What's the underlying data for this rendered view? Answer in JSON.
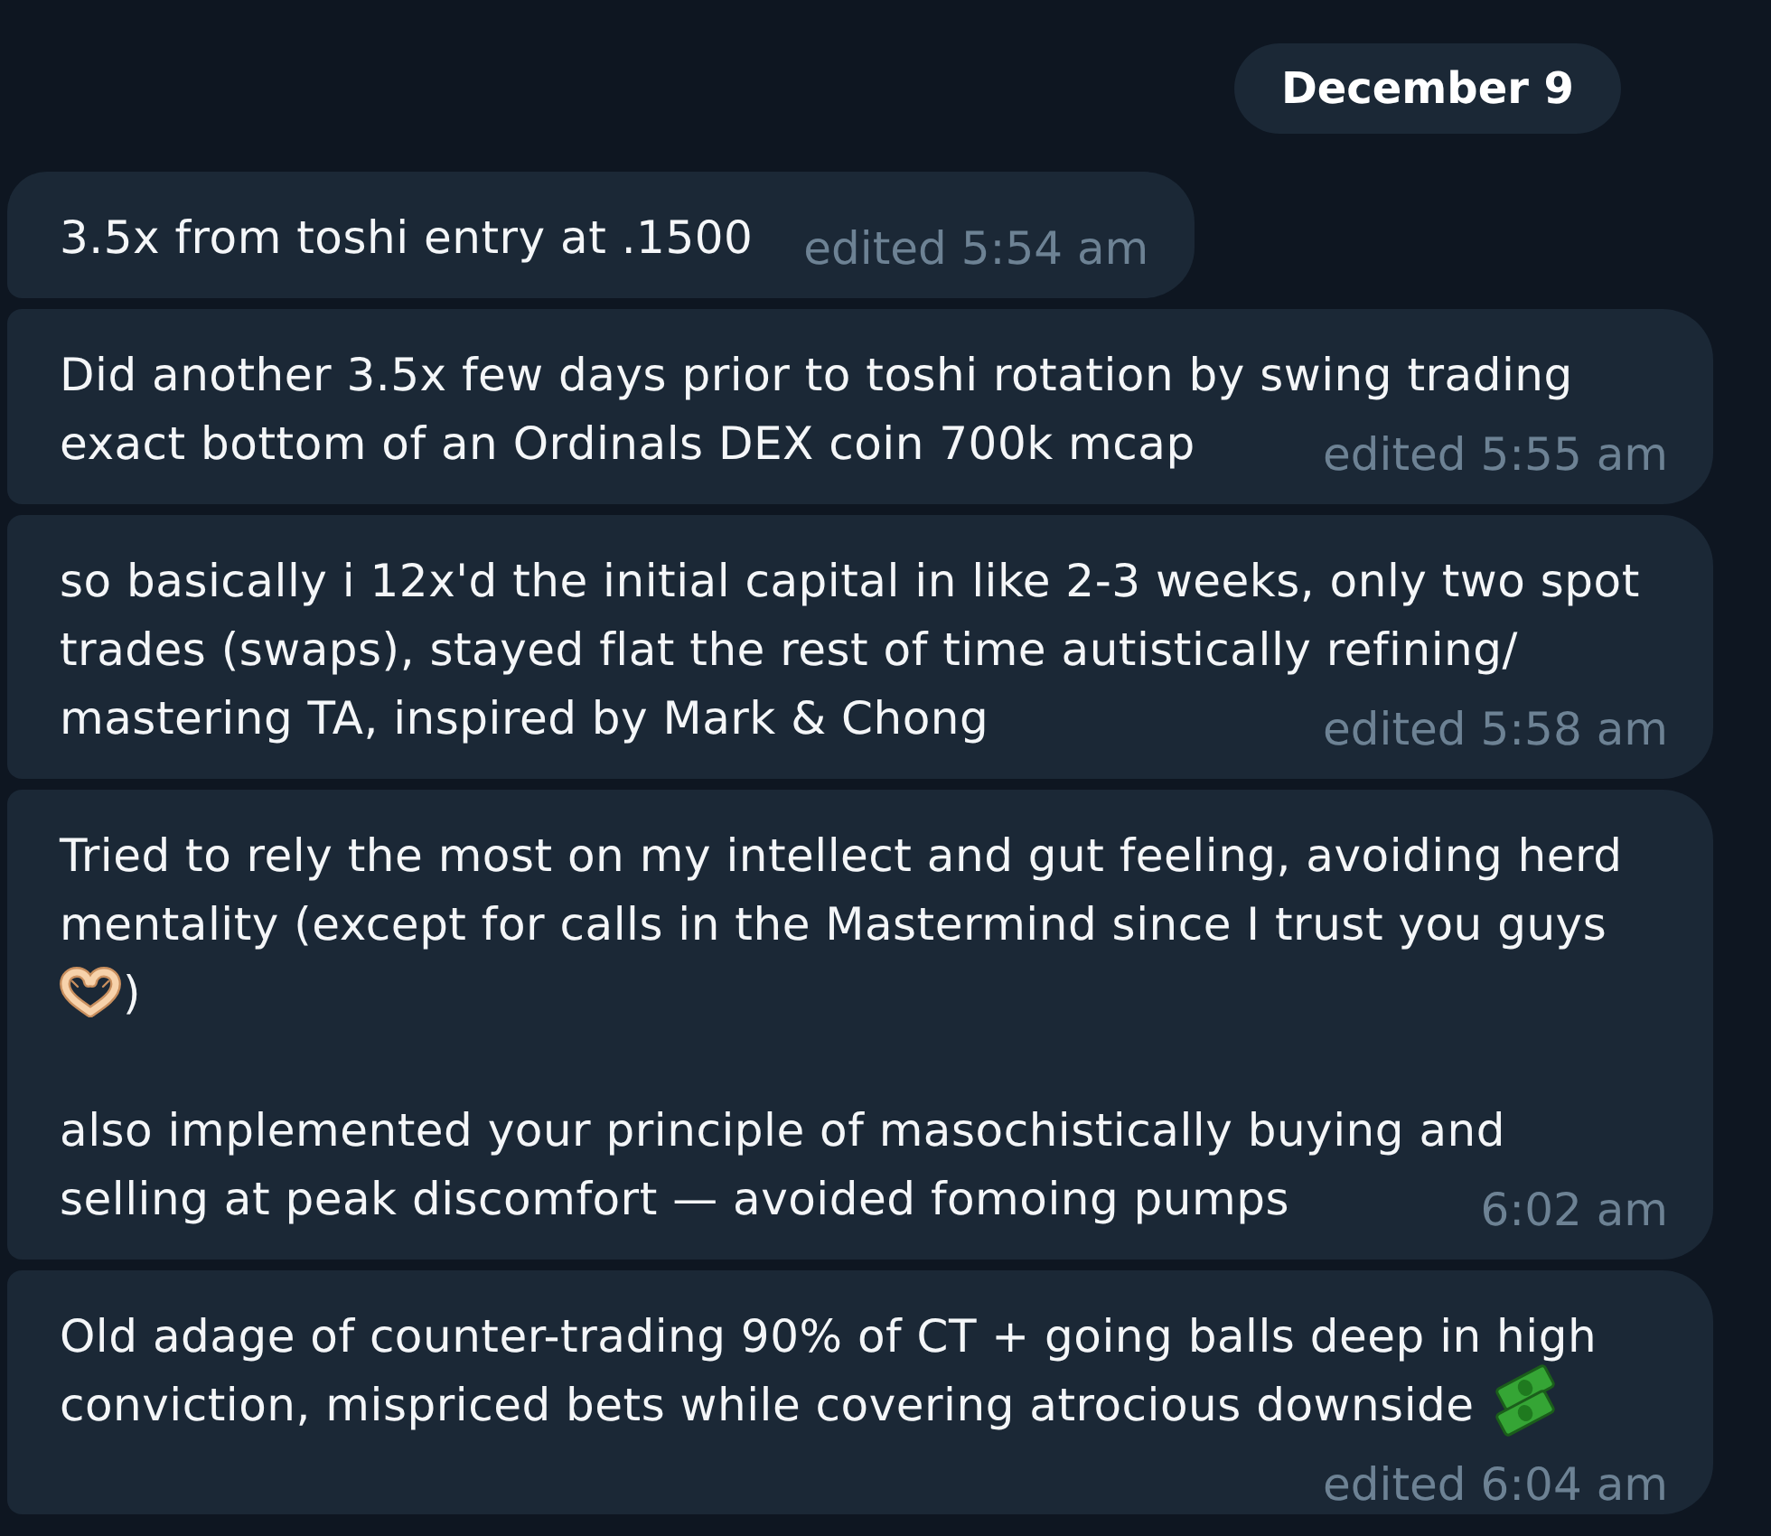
{
  "chat": {
    "date_separator": "December 9",
    "messages": [
      {
        "paragraphs": [
          [
            [
              {
                "kind": "text",
                "text": "3.5x from toshi entry at .1500"
              }
            ]
          ]
        ],
        "time": "edited 5:54 am"
      },
      {
        "paragraphs": [
          [
            [
              {
                "kind": "text",
                "text": "Did another 3.5x few days prior to toshi rotation by swing trading"
              }
            ],
            [
              {
                "kind": "text",
                "text": "exact bottom of an Ordinals DEX coin 700k mcap"
              }
            ]
          ]
        ],
        "time": "edited 5:55 am"
      },
      {
        "paragraphs": [
          [
            [
              {
                "kind": "text",
                "text": "so basically i 12x'd the initial capital in like 2-3 weeks, only two spot"
              }
            ],
            [
              {
                "kind": "text",
                "text": "trades (swaps), stayed flat the rest of time autistically refining/"
              }
            ],
            [
              {
                "kind": "text",
                "text": "mastering TA, inspired by Mark & Chong"
              }
            ]
          ]
        ],
        "time": "edited 5:58 am"
      },
      {
        "paragraphs": [
          [
            [
              {
                "kind": "text",
                "text": "Tried to rely the most on my intellect and gut feeling, avoiding herd"
              }
            ],
            [
              {
                "kind": "text",
                "text": "mentality (except for calls in the Mastermind since I trust you guys"
              }
            ],
            [
              {
                "kind": "heart_hands"
              },
              {
                "kind": "text",
                "text": ")"
              }
            ]
          ],
          [
            [
              {
                "kind": "text",
                "text": "also implemented your principle of masochistically buying and"
              }
            ],
            [
              {
                "kind": "text",
                "text": "selling at peak discomfort — avoided fomoing pumps"
              }
            ]
          ]
        ],
        "time": "6:02 am"
      },
      {
        "paragraphs": [
          [
            [
              {
                "kind": "text",
                "text": "Old adage of counter-trading 90% of CT + going balls deep in high"
              }
            ],
            [
              {
                "kind": "text",
                "text": "conviction, mispriced bets while covering atrocious downside"
              },
              {
                "kind": "banknotes"
              }
            ]
          ]
        ],
        "time": "edited 6:04 am"
      }
    ]
  }
}
